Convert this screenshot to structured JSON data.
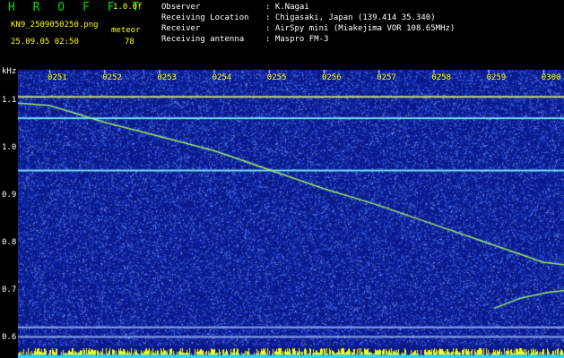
{
  "app": {
    "title": "H R O F F T",
    "version": "1.0.0f"
  },
  "file": {
    "name": "KN9_2509050250.png",
    "datetime": "25.09.05 02:50"
  },
  "meteor": {
    "label": "meteor",
    "count": "78"
  },
  "info": [
    {
      "label": "Observer",
      "value": ": K.Nagai"
    },
    {
      "label": "Receiving Location",
      "value": ": Chigasaki, Japan (139.414 35.340)"
    },
    {
      "label": "Receiver",
      "value": ": AirSpy mini (Miakejima VOR 108.65MHz)"
    },
    {
      "label": "Receiving antenna",
      "value": ": Maspro FM-3"
    }
  ],
  "chart_data": {
    "type": "heatmap",
    "ylabel": "kHz",
    "x_ticks": [
      "0251",
      "0252",
      "0253",
      "0254",
      "0255",
      "0256",
      "0257",
      "0258",
      "0259",
      "0300"
    ],
    "y_ticks": [
      "1.1",
      "1.0",
      "0.9",
      "0.8",
      "0.7",
      "0.6"
    ],
    "ylim": [
      0.585,
      1.165
    ],
    "horizontal_lines_khz": [
      1.11,
      1.065,
      0.955,
      0.625,
      0.605
    ],
    "meteor_trace": [
      {
        "minute": 0.0,
        "khz": 1.09
      },
      {
        "minute": 1.0,
        "khz": 1.055
      },
      {
        "minute": 2.0,
        "khz": 1.025
      },
      {
        "minute": 3.0,
        "khz": 0.995
      },
      {
        "minute": 4.0,
        "khz": 0.955
      },
      {
        "minute": 5.0,
        "khz": 0.915
      },
      {
        "minute": 6.0,
        "khz": 0.88
      },
      {
        "minute": 7.0,
        "khz": 0.84
      },
      {
        "minute": 8.0,
        "khz": 0.8
      },
      {
        "minute": 9.0,
        "khz": 0.76
      },
      {
        "minute": 9.6,
        "khz": 0.752
      }
    ],
    "second_trace": [
      {
        "minute": 8.1,
        "khz": 0.663
      },
      {
        "minute": 8.6,
        "khz": 0.685
      },
      {
        "minute": 9.1,
        "khz": 0.697
      },
      {
        "minute": 9.6,
        "khz": 0.703
      }
    ],
    "colors": {
      "background": "#0a1a8c",
      "noise_light": "#3a6cff",
      "line": "#9ee86a",
      "band": "#7cf0ff",
      "bottom_bar": "#ffff00"
    }
  }
}
